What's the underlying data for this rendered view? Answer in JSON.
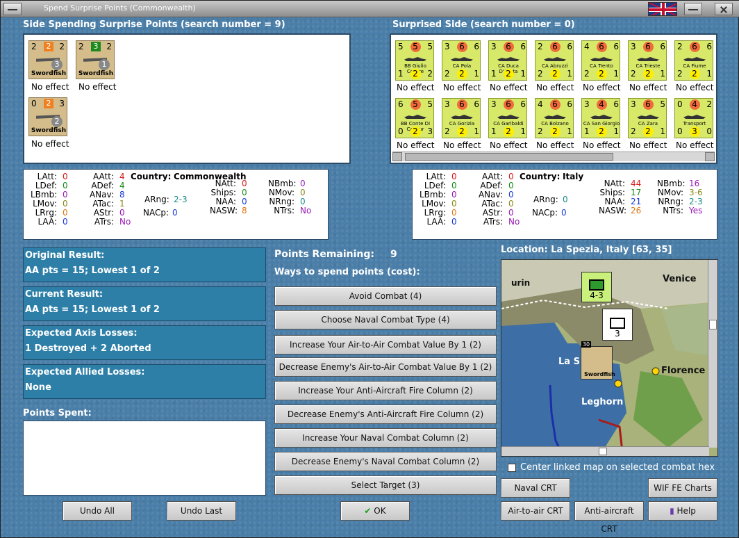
{
  "window": {
    "title": "Spend Surprise Points (Commonwealth)"
  },
  "left_side": {
    "label": "Side Spending Surprise Points (search number = 9)",
    "units": [
      {
        "top_left": "2",
        "top_mid": "2",
        "top_right": "2",
        "ring": "3",
        "name": "Swordfish",
        "effect": "No effect"
      },
      {
        "top_left": "2",
        "top_mid": "3",
        "top_right": "2",
        "ring": "1",
        "name": "Swordfish",
        "effect": "No effect"
      },
      {
        "top_left": "0",
        "top_mid": "2",
        "top_right": "3",
        "ring": "2",
        "name": "Swordfish",
        "effect": "No effect"
      }
    ]
  },
  "right_side": {
    "label": "Surprised Side (search number = 0)",
    "ships": [
      {
        "a": "5",
        "b": "5",
        "c": "5",
        "name": "BB Giulio Cesare",
        "d": "1",
        "e": "2",
        "f": "2",
        "effect": "No effect"
      },
      {
        "a": "3",
        "b": "6",
        "c": "6",
        "name": "CA Pola",
        "d": "2",
        "e": "2",
        "f": "1",
        "effect": "No effect"
      },
      {
        "a": "3",
        "b": "6",
        "c": "6",
        "name": "CA Duca D'Aosta",
        "d": "1",
        "e": "2",
        "f": "1",
        "effect": "No effect"
      },
      {
        "a": "2",
        "b": "6",
        "c": "6",
        "name": "CA Abruzzi",
        "d": "2",
        "e": "2",
        "f": "1",
        "effect": "No effect"
      },
      {
        "a": "4",
        "b": "6",
        "c": "6",
        "name": "CA Trento",
        "d": "2",
        "e": "2",
        "f": "1",
        "effect": "No effect"
      },
      {
        "a": "3",
        "b": "6",
        "c": "6",
        "name": "CA Trieste",
        "d": "2",
        "e": "2",
        "f": "1",
        "effect": "No effect"
      },
      {
        "a": "2",
        "b": "6",
        "c": "6",
        "name": "CA Fiume",
        "d": "2",
        "e": "2",
        "f": "1",
        "effect": "No effect"
      },
      {
        "a": "6",
        "b": "5",
        "c": "5",
        "name": "BB Conte Di Cavour",
        "d": "0",
        "e": "2",
        "f": "3",
        "effect": "No effect"
      },
      {
        "a": "3",
        "b": "6",
        "c": "6",
        "name": "CA Gorizia",
        "d": "2",
        "e": "2",
        "f": "1",
        "effect": "No effect"
      },
      {
        "a": "3",
        "b": "6",
        "c": "6",
        "name": "CA Garibaldi",
        "d": "1",
        "e": "2",
        "f": "1",
        "effect": "No effect"
      },
      {
        "a": "4",
        "b": "6",
        "c": "6",
        "name": "CA Bolzano",
        "d": "2",
        "e": "2",
        "f": "1",
        "effect": "No effect"
      },
      {
        "a": "3",
        "b": "4",
        "c": "6",
        "name": "CA San Giorgio",
        "d": "1",
        "e": "2",
        "f": "1",
        "effect": "No effect"
      },
      {
        "a": "3",
        "b": "6",
        "c": "5",
        "name": "CA Zara",
        "d": "2",
        "e": "2",
        "f": "1",
        "effect": "No effect"
      },
      {
        "a": "0",
        "b": "4",
        "c": "2",
        "name": "Transport",
        "d": "0",
        "e": "3",
        "f": "0",
        "effect": "No effect"
      }
    ]
  },
  "left_stats": {
    "country_label": "Country:",
    "country": "Commonwealth",
    "LAtt": "0",
    "LDef": "0",
    "LBmb": "0",
    "LMov": "0",
    "LRrg": "0",
    "LAA": "0",
    "AAtt": "4",
    "ADef": "4",
    "ANav": "8",
    "ATac": "1",
    "AStr": "0",
    "ATrs": "No",
    "ARng": "2-3",
    "NACp": "0",
    "NAtt": "0",
    "Ships": "0",
    "NAA": "0",
    "NASW": "8",
    "NBmb": "0",
    "NMov": "0",
    "NRng": "0",
    "NTrs": "No"
  },
  "right_stats": {
    "country_label": "Country:",
    "country": "Italy",
    "LAtt": "0",
    "LDef": "0",
    "LBmb": "0",
    "LMov": "0",
    "LRrg": "0",
    "LAA": "0",
    "AAtt": "0",
    "ADef": "0",
    "ANav": "0",
    "ATac": "0",
    "AStr": "0",
    "ATrs": "No",
    "ARng": "0",
    "NACp": "0",
    "NAtt": "44",
    "Ships": "17",
    "NAA": "21",
    "NASW": "26",
    "NBmb": "16",
    "NMov": "3-6",
    "NRng": "2-3",
    "NTrs": "Yes"
  },
  "results": {
    "original_label": "Original Result:",
    "original": "AA pts = 15; Lowest 1 of 2",
    "current_label": "Current Result:",
    "current": "AA pts = 15; Lowest 1 of 2",
    "axis_label": "Expected Axis Losses:",
    "axis": "1 Destroyed + 2 Aborted",
    "allied_label": "Expected Allied Losses:",
    "allied": "None",
    "spent_label": "Points Spent:"
  },
  "points": {
    "label": "Points Remaining:",
    "value": "9",
    "ways": "Ways to spend points (cost):"
  },
  "options": [
    "Avoid Combat (4)",
    "Choose Naval Combat Type (4)",
    "Increase Your Air-to-Air Combat Value By 1 (2)",
    "Decrease Enemy's Air-to-Air Combat Value By 1 (2)",
    "Increase Your Anti-Aircraft Fire Column (2)",
    "Decrease Enemy's Anti-Aircraft Fire Column (2)",
    "Increase Your Naval Combat Column (2)",
    "Decrease Enemy's Naval Combat Column (2)",
    "Select Target (3)"
  ],
  "location": "Location: La Spezia, Italy [63, 35]",
  "map": {
    "venice": "Venice",
    "florence": "Florence",
    "leghorn": "Leghorn",
    "la_spezia": "La S",
    "turin": "urin",
    "unit1": "4-3",
    "unit2": "3",
    "stack": "30",
    "sword": "Swordfish"
  },
  "center_map": "Center linked map on selected combat hex",
  "buttons": {
    "undo_all": "Undo All",
    "undo_last": "Undo Last",
    "ok": "OK",
    "naval_crt": "Naval CRT",
    "wif_fe": "WIF FE Charts",
    "air_crt": "Air-to-air CRT",
    "aa_crt": "Anti-aircraft CRT",
    "help": "Help"
  }
}
